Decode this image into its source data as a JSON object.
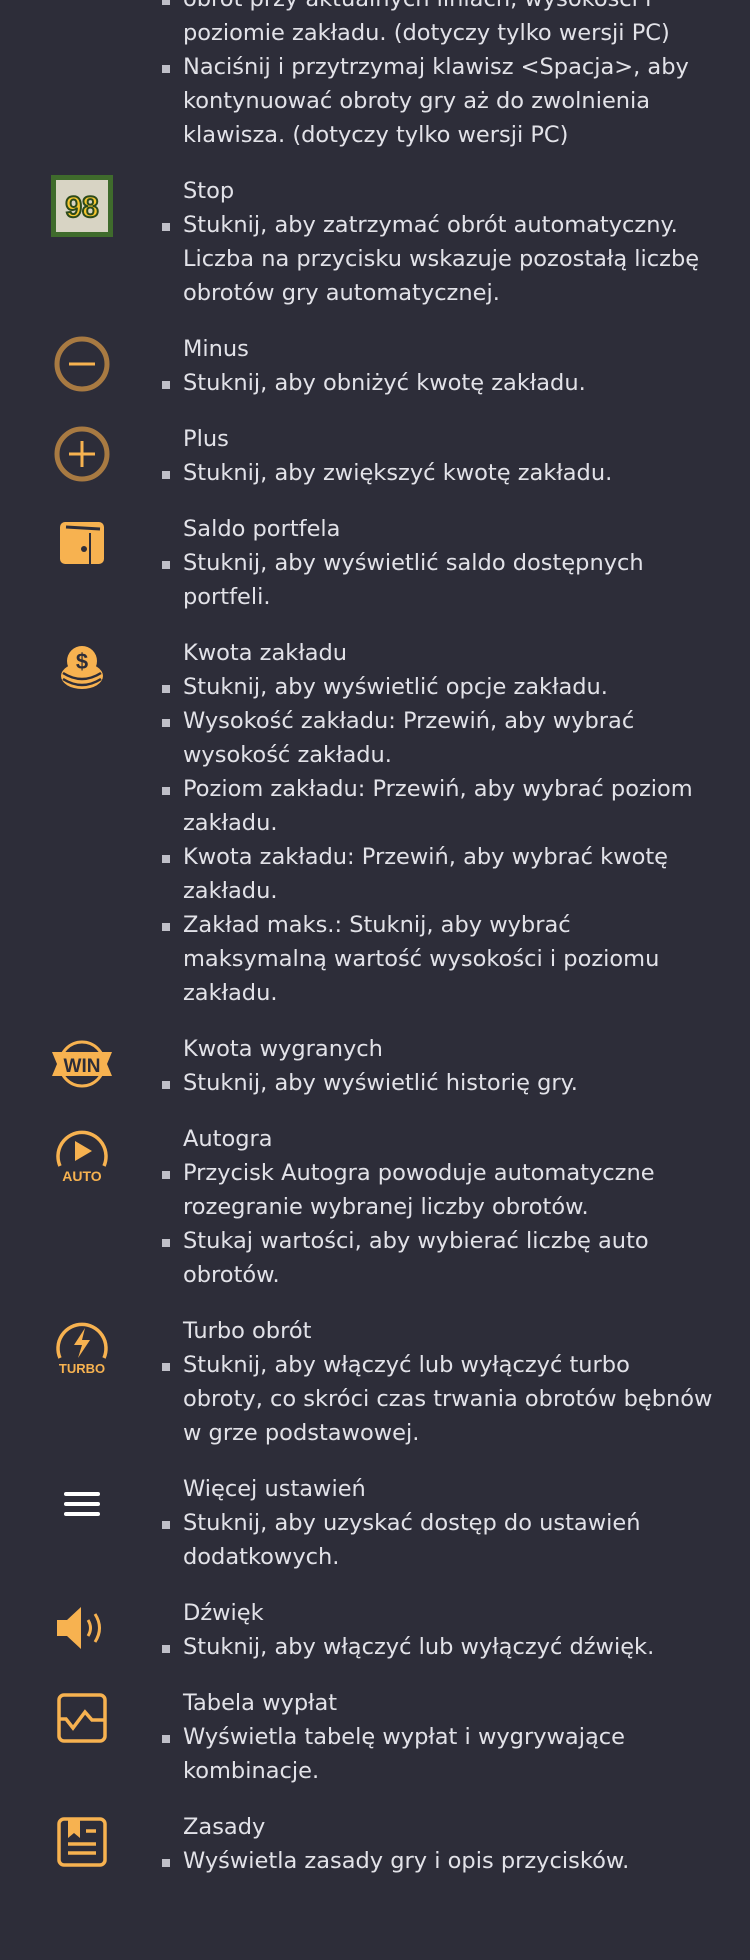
{
  "colors": {
    "background": "#2d2d39",
    "text": "#e2e2e8",
    "accent": "#f7b250"
  },
  "sections": [
    {
      "title": "",
      "icon": "",
      "items": [
        "obrót przy aktualnych liniach, wysokości i poziomie zakładu. (dotyczy tylko wersji PC)",
        "Naciśnij i przytrzymaj klawisz <Spacja>, aby kontynuować obroty gry aż do zwolnienia klawisza. (dotyczy tylko wersji PC)"
      ],
      "continued": true
    },
    {
      "title": "Stop",
      "icon": "stop-counter-icon",
      "icon_text": "98",
      "items": [
        "Stuknij, aby zatrzymać obrót automatyczny. Liczba na przycisku wskazuje pozostałą liczbę obrotów gry automatycznej."
      ]
    },
    {
      "title": "Minus",
      "icon": "minus-icon",
      "items": [
        "Stuknij, aby obniżyć kwotę zakładu."
      ]
    },
    {
      "title": "Plus",
      "icon": "plus-icon",
      "items": [
        "Stuknij, aby zwiększyć kwotę zakładu."
      ]
    },
    {
      "title": "Saldo portfela",
      "icon": "wallet-icon",
      "items": [
        "Stuknij, aby wyświetlić saldo dostępnych portfeli."
      ]
    },
    {
      "title": "Kwota zakładu",
      "icon": "coins-icon",
      "items": [
        "Stuknij, aby wyświetlić opcje zakładu.",
        "Wysokość zakładu: Przewiń, aby wybrać wysokość zakładu.",
        "Poziom zakładu: Przewiń, aby wybrać poziom zakładu.",
        "Kwota zakładu: Przewiń, aby wybrać kwotę zakładu.",
        "Zakład maks.: Stuknij, aby wybrać maksymalną wartość wysokości i poziomu zakładu."
      ]
    },
    {
      "title": "Kwota wygranych",
      "icon": "win-icon",
      "icon_text": "WIN",
      "items": [
        "Stuknij, aby wyświetlić historię gry."
      ]
    },
    {
      "title": "Autogra",
      "icon": "auto-play-icon",
      "icon_text": "AUTO",
      "items": [
        "Przycisk Autogra powoduje automatyczne rozegranie wybranej liczby obrotów.",
        "Stukaj wartości, aby wybierać liczbę auto obrotów."
      ]
    },
    {
      "title": "Turbo obrót",
      "icon": "turbo-icon",
      "icon_text": "TURBO",
      "items": [
        "Stuknij, aby włączyć lub wyłączyć turbo obroty, co skróci czas trwania obrotów bębnów w grze podstawowej."
      ]
    },
    {
      "title": "Więcej ustawień",
      "icon": "menu-icon",
      "items": [
        "Stuknij, aby uzyskać dostęp do ustawień dodatkowych."
      ]
    },
    {
      "title": "Dźwięk",
      "icon": "sound-icon",
      "items": [
        "Stuknij, aby włączyć lub wyłączyć dźwięk."
      ]
    },
    {
      "title": "Tabela wypłat",
      "icon": "paytable-icon",
      "items": [
        "Wyświetla tabelę wypłat i wygrywające kombinacje."
      ]
    },
    {
      "title": "Zasady",
      "icon": "rules-icon",
      "items": [
        "Wyświetla zasady gry i opis przycisków."
      ]
    }
  ]
}
